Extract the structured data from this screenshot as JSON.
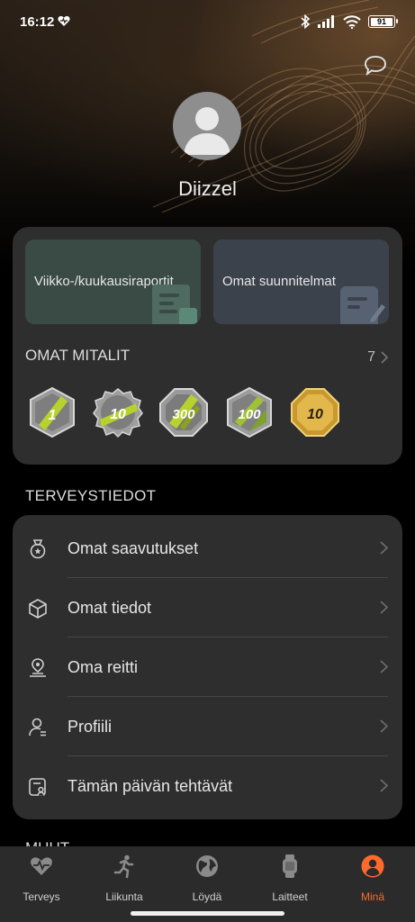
{
  "status_bar": {
    "time": "16:12",
    "battery": "91"
  },
  "profile": {
    "username": "Diizzel"
  },
  "cards": {
    "reports_label": "Viikko-/kuukausiraportit",
    "plans_label": "Omat suunnitelmat"
  },
  "medals": {
    "title": "OMAT MITALIT",
    "count": "7",
    "items": [
      {
        "label": "1",
        "color": "#b8b8b8"
      },
      {
        "label": "10",
        "color": "#b8b8b8"
      },
      {
        "label": "300",
        "color": "#b8b8b8"
      },
      {
        "label": "100",
        "color": "#b8b8b8"
      },
      {
        "label": "10",
        "color": "#d9b04a"
      }
    ]
  },
  "health": {
    "section_title": "TERVEYSTIEDOT",
    "items": [
      {
        "label": "Omat saavutukset",
        "icon": "medal-icon"
      },
      {
        "label": "Omat tiedot",
        "icon": "cube-icon"
      },
      {
        "label": "Oma reitti",
        "icon": "route-icon"
      },
      {
        "label": "Profiili",
        "icon": "person-icon"
      },
      {
        "label": "Tämän päivän tehtävät",
        "icon": "task-icon"
      }
    ]
  },
  "next_section_peek": "MUUT",
  "nav": {
    "items": [
      {
        "label": "Terveys",
        "icon": "heart-icon"
      },
      {
        "label": "Liikunta",
        "icon": "running-icon"
      },
      {
        "label": "Löydä",
        "icon": "globe-icon"
      },
      {
        "label": "Laitteet",
        "icon": "watch-icon"
      },
      {
        "label": "Minä",
        "icon": "me-icon"
      }
    ],
    "active_color": "#ff6a2c"
  }
}
